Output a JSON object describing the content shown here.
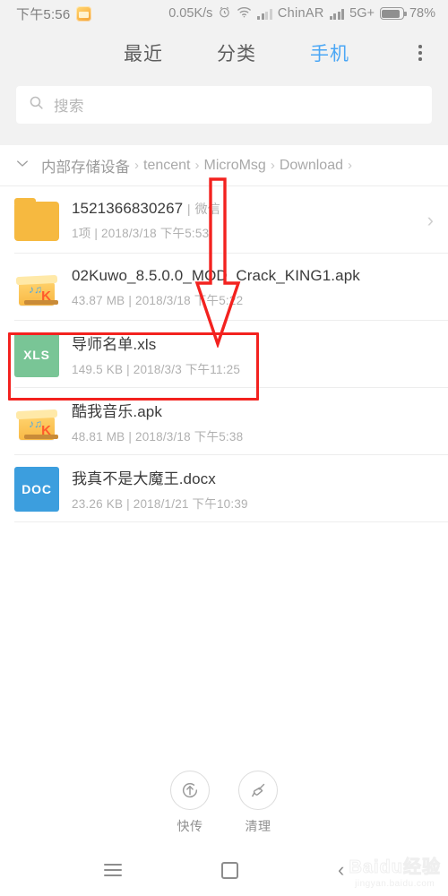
{
  "status_bar": {
    "time": "下午5:56",
    "app_icon": "kuwo-music-notification-icon",
    "network_speed": "0.05K/s",
    "alarm_icon": "alarm-clock-icon",
    "wifi_icon": "wifi-icon",
    "signal_icon_1": "signal-bars-icon",
    "carrier": "ChinAR",
    "signal_icon_2": "signal-bars-icon",
    "network_type": "5G+",
    "battery_icon": "battery-icon",
    "battery_percent": "78%"
  },
  "tabs": [
    {
      "label": "最近",
      "active": false,
      "name": "tab-recent"
    },
    {
      "label": "分类",
      "active": false,
      "name": "tab-category"
    },
    {
      "label": "手机",
      "active": true,
      "name": "tab-phone"
    }
  ],
  "more_menu_icon": "overflow-menu-icon",
  "search": {
    "placeholder": "搜索",
    "icon": "search-icon"
  },
  "breadcrumb": {
    "collapse_icon": "chevron-down-icon",
    "items": [
      "内部存储设备",
      "tencent",
      "MicroMsg",
      "Download"
    ],
    "separator": "›",
    "trailing_separator": "›"
  },
  "files": [
    {
      "name": "1521366830267",
      "name_suffix": "微信",
      "name_separator": "|",
      "subtitle": "1项 | 2018/3/18 下午5:53",
      "icon_type": "folder",
      "icon_label": "",
      "has_chevron": true,
      "data_name": "list-item-folder-1521366830267"
    },
    {
      "name": "02Kuwo_8.5.0.0_MOD_Crack_KING1.apk",
      "name_suffix": "",
      "name_separator": "",
      "subtitle": "43.87 MB | 2018/3/18 下午5:22",
      "icon_type": "apk",
      "icon_label": "",
      "has_chevron": false,
      "data_name": "list-item-file-kuwo-mod-apk"
    },
    {
      "name": "导师名单.xls",
      "name_suffix": "",
      "name_separator": "",
      "subtitle": "149.5 KB | 2018/3/3 下午11:25",
      "icon_type": "xls",
      "icon_label": "XLS",
      "has_chevron": false,
      "data_name": "list-item-file-daoshi-mingdan-xls"
    },
    {
      "name": "酷我音乐.apk",
      "name_suffix": "",
      "name_separator": "",
      "subtitle": "48.81 MB | 2018/3/18 下午5:38",
      "icon_type": "apk",
      "icon_label": "",
      "has_chevron": false,
      "data_name": "list-item-file-kuwo-music-apk"
    },
    {
      "name": "我真不是大魔王.docx",
      "name_suffix": "",
      "name_separator": "",
      "subtitle": "23.26 KB | 2018/1/21 下午10:39",
      "icon_type": "doc",
      "icon_label": "DOC",
      "has_chevron": false,
      "data_name": "list-item-file-damowang-docx"
    }
  ],
  "annotations": {
    "arrow_color": "#f3221f",
    "box_color": "#f3221f",
    "arrow_name": "red-down-arrow-annotation",
    "box_name": "red-highlight-box-annotation"
  },
  "bottom_tools": [
    {
      "label": "快传",
      "icon": "upload-circle-icon",
      "name": "tool-quick-transfer"
    },
    {
      "label": "清理",
      "icon": "broom-icon",
      "name": "tool-clean"
    }
  ],
  "nav_bar": {
    "menu_icon": "menu-icon",
    "home_icon": "home-square-icon",
    "back_icon": "back-chevron-icon"
  },
  "watermark": {
    "main": "Baidu经验",
    "sub": "jingyan.baidu.com"
  },
  "colors": {
    "accent": "#4ba7f5",
    "folder": "#f6b940",
    "xls": "#79c596",
    "doc": "#3c9ede",
    "annotation": "#f3221f",
    "chrome_bg": "#f2f2f2"
  }
}
